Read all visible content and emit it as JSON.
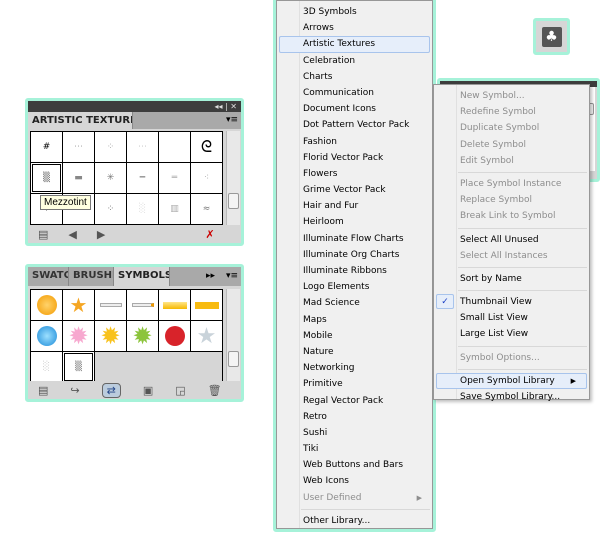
{
  "artistic_panel": {
    "tab": "ARTISTIC TEXTURES",
    "tooltip": "Mezzotint",
    "controls": {
      "collapse": "◂◂",
      "close": "✕",
      "menu": "▾≡"
    }
  },
  "symbols_panel": {
    "tabs": [
      "SWATCHES",
      "BRUSHES",
      "SYMBOLS"
    ],
    "active_tab": "SYMBOLS",
    "controls": {
      "expand": "▸▸",
      "menu": "▾≡"
    }
  },
  "library_menu": {
    "items": [
      {
        "label": "3D Symbols"
      },
      {
        "label": "Arrows"
      },
      {
        "label": "Artistic Textures",
        "highlighted": true
      },
      {
        "label": "Celebration"
      },
      {
        "label": "Charts"
      },
      {
        "label": "Communication"
      },
      {
        "label": "Document Icons"
      },
      {
        "label": "Dot Pattern Vector Pack"
      },
      {
        "label": "Fashion"
      },
      {
        "label": "Florid Vector Pack"
      },
      {
        "label": "Flowers"
      },
      {
        "label": "Grime Vector Pack"
      },
      {
        "label": "Hair and Fur"
      },
      {
        "label": "Heirloom"
      },
      {
        "label": "Illuminate Flow Charts"
      },
      {
        "label": "Illuminate Org Charts"
      },
      {
        "label": "Illuminate Ribbons"
      },
      {
        "label": "Logo Elements"
      },
      {
        "label": "Mad Science"
      },
      {
        "label": "Maps"
      },
      {
        "label": "Mobile"
      },
      {
        "label": "Nature"
      },
      {
        "label": "Networking"
      },
      {
        "label": "Primitive"
      },
      {
        "label": "Regal Vector Pack"
      },
      {
        "label": "Retro"
      },
      {
        "label": "Sushi"
      },
      {
        "label": "Tiki"
      },
      {
        "label": "Web Buttons and Bars"
      },
      {
        "label": "Web Icons"
      },
      {
        "label": "User Defined",
        "disabled": true,
        "submenu": true
      }
    ],
    "other": "Other Library..."
  },
  "panel_menu": {
    "groups": [
      [
        {
          "label": "New Symbol...",
          "disabled": true
        },
        {
          "label": "Redefine Symbol",
          "disabled": true
        },
        {
          "label": "Duplicate Symbol",
          "disabled": true
        },
        {
          "label": "Delete Symbol",
          "disabled": true
        },
        {
          "label": "Edit Symbol",
          "disabled": true
        }
      ],
      [
        {
          "label": "Place Symbol Instance",
          "disabled": true
        },
        {
          "label": "Replace Symbol",
          "disabled": true
        },
        {
          "label": "Break Link to Symbol",
          "disabled": true
        }
      ],
      [
        {
          "label": "Select All Unused"
        },
        {
          "label": "Select All Instances",
          "disabled": true
        }
      ],
      [
        {
          "label": "Sort by Name"
        }
      ],
      [
        {
          "label": "Thumbnail View",
          "checked": true
        },
        {
          "label": "Small List View"
        },
        {
          "label": "Large List View"
        }
      ],
      [
        {
          "label": "Symbol Options...",
          "disabled": true
        }
      ],
      [
        {
          "label": "Open Symbol Library",
          "highlighted": true,
          "submenu": true
        },
        {
          "label": "Save Symbol Library..."
        }
      ]
    ],
    "check": "✓",
    "submenu_arrow": "▶"
  },
  "club_icon": "♣"
}
